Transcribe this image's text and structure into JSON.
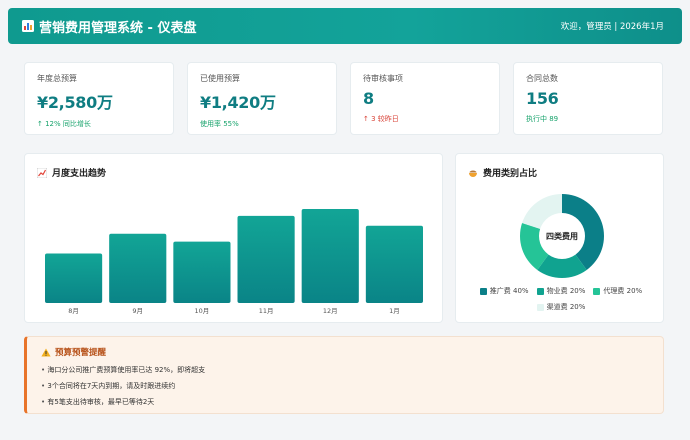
{
  "header": {
    "title": "营销费用管理系统 - 仪表盘",
    "user_info": "欢迎，管理员 | 2026年1月"
  },
  "stats": [
    {
      "label": "年度总预算",
      "value": "¥2,580万",
      "sub": "↑ 12% 同比增长",
      "sub_color": "green"
    },
    {
      "label": "已使用预算",
      "value": "¥1,420万",
      "sub": "使用率 55%",
      "sub_color": "green"
    },
    {
      "label": "待审核事项",
      "value": "8",
      "sub": "↑ 3 较昨日",
      "sub_color": "red"
    },
    {
      "label": "合同总数",
      "value": "156",
      "sub": "执行中 89",
      "sub_color": "green"
    }
  ],
  "trend": {
    "title": "月度支出趋势",
    "icon": "chart-trend-icon"
  },
  "chart_data": [
    {
      "type": "bar",
      "title": "月度支出趋势",
      "categories": [
        "8月",
        "9月",
        "10月",
        "11月",
        "12月",
        "1月"
      ],
      "values": [
        50,
        70,
        62,
        88,
        95,
        78
      ],
      "ylim": [
        0,
        100
      ],
      "grid": false,
      "color": "#0f9a8f"
    },
    {
      "type": "pie",
      "title": "费用类别占比",
      "center_label": "四类费用",
      "categories": [
        "推广费",
        "物业费",
        "代理费",
        "渠道费"
      ],
      "values": [
        40,
        20,
        20,
        20
      ],
      "colors": [
        "#0b7f88",
        "#10a390",
        "#25c497",
        "#e3f4f1"
      ]
    }
  ],
  "category": {
    "title": "费用类别占比",
    "icon": "pie-icon",
    "center_label": "四类费用",
    "legend": [
      "推广费 40%",
      "物业费 20%",
      "代理费 20%",
      "渠道费 20%"
    ],
    "colors": [
      "#0b7f88",
      "#10a390",
      "#25c497",
      "#e3f4f1"
    ]
  },
  "alert": {
    "title": "预算预警提醒",
    "items": [
      "海口分公司推广费预算使用率已达 92%，即将超支",
      "3个合同将在7天内到期，请及时跟进续约",
      "有5笔支出待审核，最早已等待2天"
    ]
  }
}
